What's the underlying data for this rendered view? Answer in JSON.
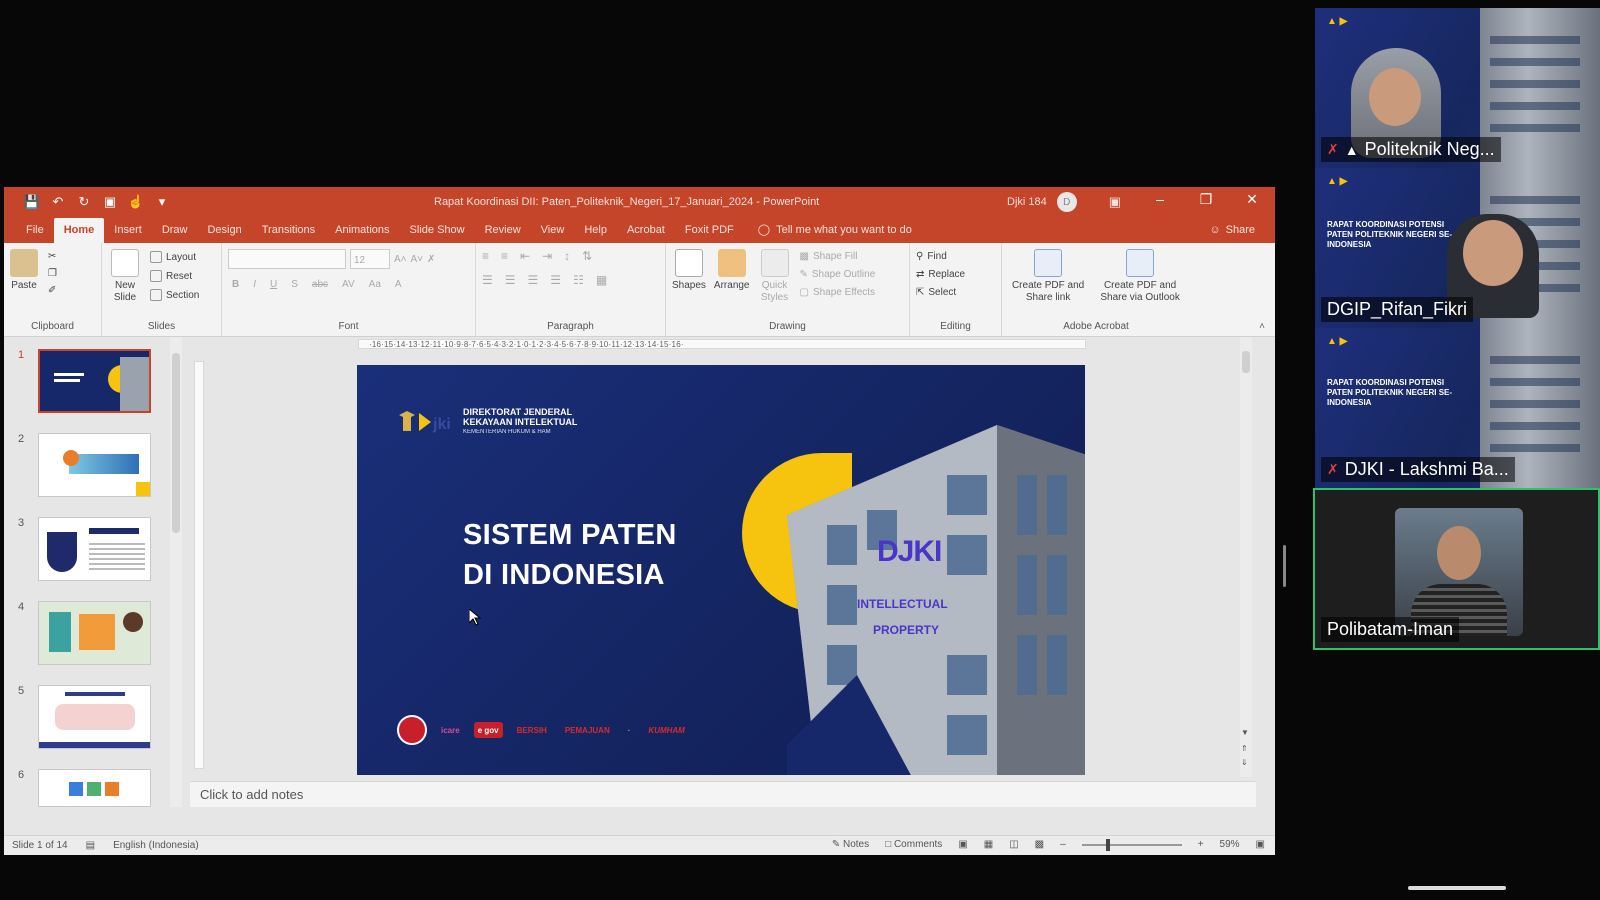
{
  "window": {
    "title": "Rapat Koordinasi DII: Paten_Politeknik_Negeri_17_Januari_2024  -  PowerPoint",
    "user": "Djki 184",
    "avatar_initial": "D"
  },
  "tabs": [
    "File",
    "Home",
    "Insert",
    "Draw",
    "Design",
    "Transitions",
    "Animations",
    "Slide Show",
    "Review",
    "View",
    "Help",
    "Acrobat",
    "Foxit PDF"
  ],
  "active_tab": "Home",
  "tell_me": "Tell me what you want to do",
  "share": "Share",
  "ribbon": {
    "clipboard": {
      "paste": "Paste",
      "label": "Clipboard"
    },
    "slides": {
      "new_slide": "New Slide",
      "layout": "Layout",
      "reset": "Reset",
      "section": "Section",
      "label": "Slides"
    },
    "font": {
      "size_value": "12",
      "label": "Font",
      "buttons": [
        "B",
        "I",
        "U",
        "S",
        "abc",
        "AV",
        "Aa",
        "A"
      ]
    },
    "paragraph": {
      "label": "Paragraph"
    },
    "drawing": {
      "shapes": "Shapes",
      "arrange": "Arrange",
      "quick_styles": "Quick Styles",
      "shape_fill": "Shape Fill",
      "shape_outline": "Shape Outline",
      "shape_effects": "Shape Effects",
      "label": "Drawing"
    },
    "editing": {
      "find": "Find",
      "replace": "Replace",
      "select": "Select",
      "label": "Editing"
    },
    "acrobat": {
      "create_share_link": "Create PDF and Share link",
      "create_share_outlook": "Create PDF and Share via Outlook",
      "label": "Adobe Acrobat"
    }
  },
  "ruler_text": "·16·15·14·13·12·11·10·9·8·7·6·5·4·3·2·1·0·1·2·3·4·5·6·7·8·9·10·11·12·13·14·15·16·",
  "thumbnails": [
    {
      "num": "1",
      "selected": true
    },
    {
      "num": "2",
      "selected": false
    },
    {
      "num": "3",
      "selected": false
    },
    {
      "num": "4",
      "selected": false
    },
    {
      "num": "5",
      "selected": false
    },
    {
      "num": "6",
      "selected": false
    }
  ],
  "slide": {
    "logo_line1": "DIREKTORAT JENDERAL",
    "logo_line2": "KEKAYAAN INTELEKTUAL",
    "logo_line3": "KEMENTERIAN HUKUM & HAM",
    "headline_1": "SISTEM PATEN",
    "headline_2": "DI INDONESIA",
    "building_brand": "DJKI",
    "building_text_1": "INTELLECTUAL",
    "building_text_2": "PROPERTY",
    "sponsors": [
      "icare",
      "e gov",
      "BERSIH",
      "PEMAJUAN",
      "·",
      "KUMHAM"
    ]
  },
  "notes_placeholder": "Click to add notes",
  "status": {
    "slide_count": "Slide 1 of 14",
    "language": "English (Indonesia)",
    "notes": "Notes",
    "comments": "Comments",
    "zoom": "59%"
  },
  "participants": [
    {
      "name": "Politeknik Neg...",
      "pinned": true,
      "muted": true
    },
    {
      "name": "DGIP_Rifan_Fikri",
      "pinned": false,
      "muted": false
    },
    {
      "name": "DJKI - Lakshmi Ba...",
      "pinned": false,
      "muted": true
    },
    {
      "name": "Polibatam-Iman",
      "pinned": false,
      "muted": false,
      "active": true
    }
  ],
  "tile_slide_title": "RAPAT KOORDINASI POTENSI PATEN POLITEKNIK NEGERI SE-INDONESIA",
  "colors": {
    "ppt_accent": "#c4452a",
    "slide_bg": "#17286a",
    "yellow": "#f6c40f",
    "active_speaker": "#2ac56b"
  }
}
